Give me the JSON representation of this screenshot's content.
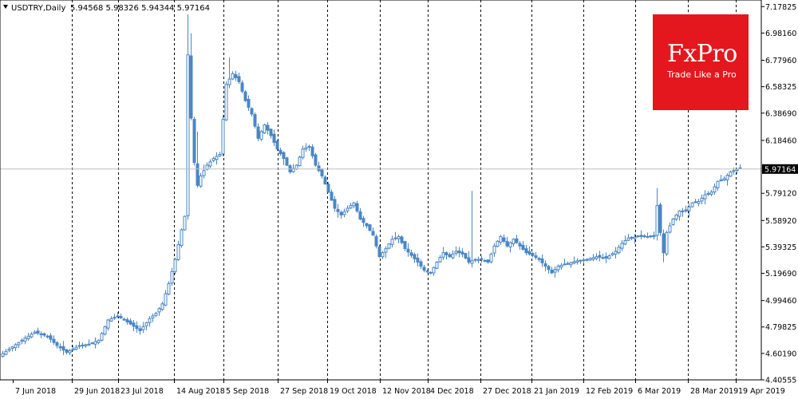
{
  "chart_data": {
    "type": "candlestick",
    "title": "USDTRY,Daily",
    "ohlc_header": [
      "5.94568",
      "5.98326",
      "5.94344",
      "5.97164"
    ],
    "current_price": "5.97164",
    "ylim": [
      4.4055,
      7.2272
    ],
    "y_ticks": [
      "7.17825",
      "6.98160",
      "6.77960",
      "6.58325",
      "6.38690",
      "6.18460",
      "5.97164",
      "5.79120",
      "5.58920",
      "5.39325",
      "5.19690",
      "4.99460",
      "4.79825",
      "4.60190",
      "4.40555"
    ],
    "x_labels": [
      "7 Jun 2018",
      "29 Jun 2018",
      "23 Jul 2018",
      "14 Aug 2018",
      "5 Sep 2018",
      "27 Sep 2018",
      "19 Oct 2018",
      "12 Nov 2018",
      "4 Dec 2018",
      "27 Dec 2018",
      "21 Jan 2019",
      "12 Feb 2019",
      "6 Mar 2019",
      "28 Mar 2019",
      "19 Apr 2019"
    ],
    "anchors": [
      [
        0,
        4.6
      ],
      [
        6,
        4.7
      ],
      [
        10,
        4.76
      ],
      [
        14,
        4.73
      ],
      [
        17,
        4.66
      ],
      [
        20,
        4.61
      ],
      [
        24,
        4.66
      ],
      [
        27,
        4.67
      ],
      [
        30,
        4.7
      ],
      [
        33,
        4.85
      ],
      [
        36,
        4.88
      ],
      [
        40,
        4.82
      ],
      [
        43,
        4.77
      ],
      [
        46,
        4.86
      ],
      [
        48,
        4.9
      ],
      [
        50,
        4.97
      ],
      [
        52,
        5.12
      ],
      [
        54,
        5.3
      ],
      [
        56,
        5.52
      ],
      [
        57,
        5.62
      ],
      [
        58,
        6.82
      ],
      [
        59,
        6.35
      ],
      [
        60,
        6.02
      ],
      [
        61,
        5.85
      ],
      [
        62,
        5.92
      ],
      [
        64,
        6.0
      ],
      [
        66,
        6.05
      ],
      [
        68,
        6.08
      ],
      [
        70,
        6.6
      ],
      [
        72,
        6.68
      ],
      [
        74,
        6.62
      ],
      [
        76,
        6.48
      ],
      [
        78,
        6.38
      ],
      [
        80,
        6.2
      ],
      [
        82,
        6.3
      ],
      [
        84,
        6.22
      ],
      [
        86,
        6.12
      ],
      [
        88,
        6.05
      ],
      [
        90,
        5.95
      ],
      [
        92,
        6.0
      ],
      [
        94,
        6.12
      ],
      [
        96,
        6.14
      ],
      [
        98,
        6.0
      ],
      [
        100,
        5.92
      ],
      [
        102,
        5.8
      ],
      [
        104,
        5.68
      ],
      [
        106,
        5.63
      ],
      [
        108,
        5.68
      ],
      [
        110,
        5.72
      ],
      [
        112,
        5.6
      ],
      [
        114,
        5.55
      ],
      [
        116,
        5.48
      ],
      [
        118,
        5.32
      ],
      [
        120,
        5.38
      ],
      [
        122,
        5.45
      ],
      [
        124,
        5.47
      ],
      [
        126,
        5.38
      ],
      [
        128,
        5.33
      ],
      [
        130,
        5.28
      ],
      [
        132,
        5.22
      ],
      [
        134,
        5.2
      ],
      [
        136,
        5.28
      ],
      [
        138,
        5.35
      ],
      [
        140,
        5.32
      ],
      [
        142,
        5.36
      ],
      [
        144,
        5.34
      ],
      [
        146,
        5.28
      ],
      [
        148,
        5.3
      ],
      [
        150,
        5.3
      ],
      [
        152,
        5.28
      ],
      [
        154,
        5.4
      ],
      [
        156,
        5.47
      ],
      [
        158,
        5.4
      ],
      [
        160,
        5.45
      ],
      [
        162,
        5.4
      ],
      [
        164,
        5.35
      ],
      [
        166,
        5.33
      ],
      [
        168,
        5.3
      ],
      [
        170,
        5.25
      ],
      [
        172,
        5.2
      ],
      [
        174,
        5.25
      ],
      [
        177,
        5.27
      ],
      [
        180,
        5.29
      ],
      [
        183,
        5.3
      ],
      [
        186,
        5.32
      ],
      [
        189,
        5.31
      ],
      [
        192,
        5.36
      ],
      [
        194,
        5.42
      ],
      [
        196,
        5.46
      ],
      [
        199,
        5.47
      ],
      [
        202,
        5.47
      ],
      [
        204,
        5.47
      ],
      [
        205,
        5.7
      ],
      [
        206,
        5.5
      ],
      [
        207,
        5.35
      ],
      [
        208,
        5.5
      ],
      [
        210,
        5.6
      ],
      [
        212,
        5.66
      ],
      [
        214,
        5.66
      ],
      [
        216,
        5.72
      ],
      [
        218,
        5.73
      ],
      [
        220,
        5.78
      ],
      [
        222,
        5.8
      ],
      [
        224,
        5.88
      ],
      [
        226,
        5.9
      ],
      [
        228,
        5.95
      ],
      [
        231,
        5.98
      ]
    ],
    "spikes": [
      [
        58,
        7.12
      ],
      [
        59,
        6.98
      ],
      [
        61,
        6.25
      ],
      [
        71,
        6.8
      ],
      [
        88,
        6.0
      ],
      [
        147,
        5.81
      ],
      [
        205,
        5.83
      ],
      [
        206,
        5.52
      ],
      [
        207,
        5.28
      ],
      [
        208,
        5.4
      ]
    ],
    "n_bars": 232,
    "grid": "vertical dashed at x labels",
    "colors": {
      "candle": "#4a86c5",
      "grid": "#000000",
      "price_line": "#c0c0c0",
      "price_label_bg": "#000000",
      "brand": "#e4171e"
    }
  },
  "logo": {
    "name": "FxPro",
    "tagline": "Trade Like a Pro"
  }
}
